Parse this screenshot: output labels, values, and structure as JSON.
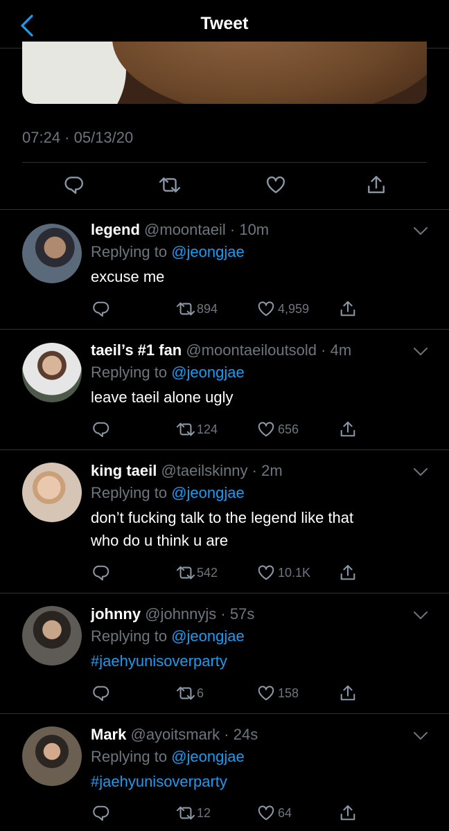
{
  "header": {
    "title": "Tweet",
    "back_icon": "chevron-left-icon"
  },
  "tweet": {
    "timestamp": "07:24 · 05/13/20"
  },
  "colors": {
    "accent": "#1d9bf0",
    "muted": "#6e767d",
    "divider": "#2f3336",
    "background": "#000000"
  },
  "replies": [
    {
      "name": "legend",
      "handle": "@moontaeil",
      "time": "10m",
      "replying_prefix": "Replying to ",
      "replying_to": "@jeongjae",
      "text": "excuse me",
      "retweets": "894",
      "likes": "4,959"
    },
    {
      "name": "taeil’s #1 fan",
      "handle": "@moontaeiloutsold",
      "time": "4m",
      "replying_prefix": "Replying to ",
      "replying_to": "@jeongjae",
      "text": "leave taeil alone ugly",
      "retweets": "124",
      "likes": "656"
    },
    {
      "name": "king taeil",
      "handle": "@taeilskinny",
      "time": "2m",
      "replying_prefix": "Replying to ",
      "replying_to": "@jeongjae",
      "text_line1": "don’t fucking talk to the legend like that",
      "text_line2": "who do u think u are",
      "retweets": "542",
      "likes": "10.1K"
    },
    {
      "name": "johnny",
      "handle": "@johnnyjs",
      "time": "57s",
      "replying_prefix": "Replying to ",
      "replying_to": "@jeongjae",
      "text": "#jaehyunisoverparty",
      "retweets": "6",
      "likes": "158"
    },
    {
      "name": "Mark",
      "handle": "@ayoitsmark",
      "time": "24s",
      "replying_prefix": "Replying to ",
      "replying_to": "@jeongjae",
      "text": "#jaehyunisoverparty",
      "retweets": "12",
      "likes": "64"
    }
  ]
}
